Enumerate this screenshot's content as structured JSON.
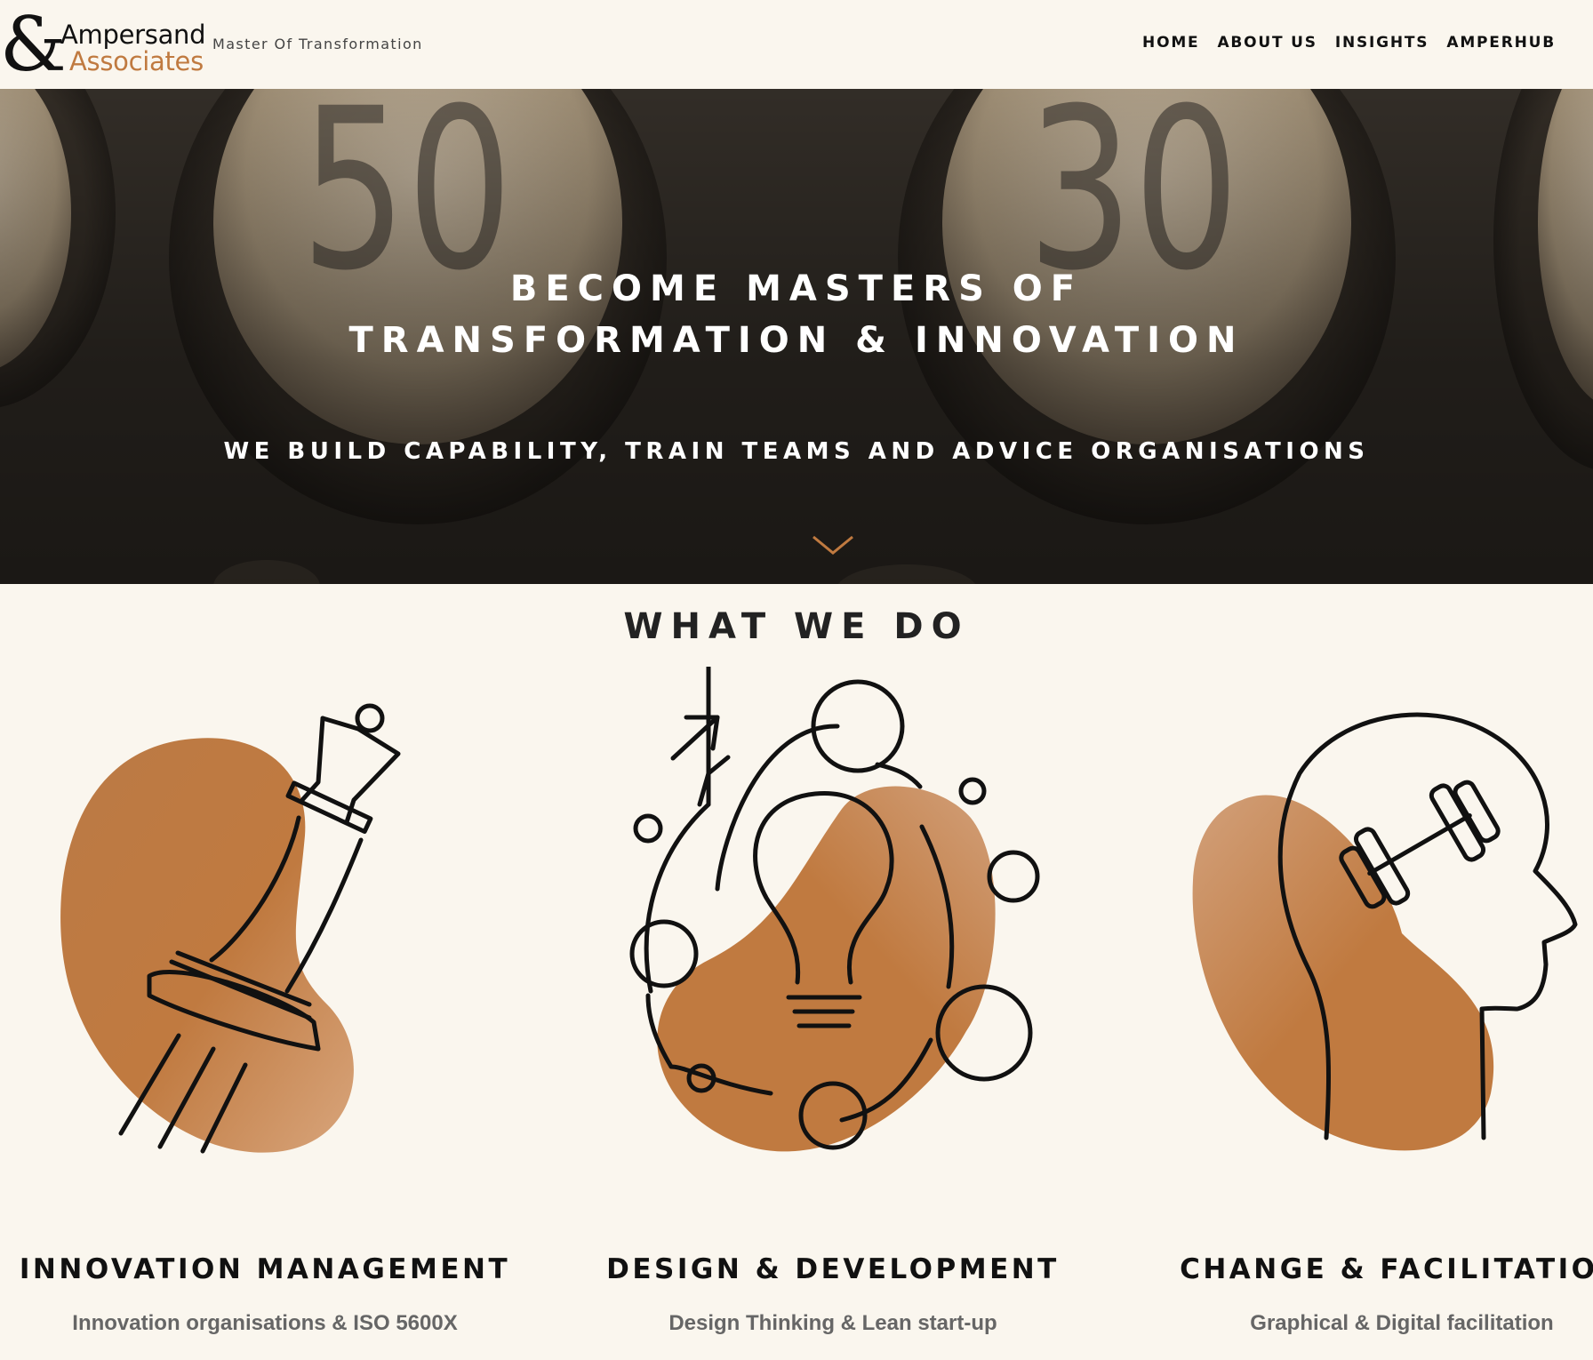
{
  "header": {
    "logo_symbol": "&",
    "logo_line1": "Ampersand",
    "logo_line2": "Associates",
    "tagline": "Master Of Transformation",
    "nav": [
      {
        "label": "HOME"
      },
      {
        "label": "ABOUT US"
      },
      {
        "label": "INSIGHTS"
      },
      {
        "label": "AMPERHUB"
      }
    ]
  },
  "hero": {
    "title_line1": "BECOME MASTERS OF",
    "title_line2": "TRANSFORMATION & INNOVATION",
    "subtitle": "WE BUILD CAPABILITY, TRAIN TEAMS AND ADVICE ORGANISATIONS",
    "background_numbers": [
      "50",
      "30"
    ],
    "scroll_icon": "chevron-down-icon"
  },
  "services": {
    "title": "WHAT WE DO",
    "items": [
      {
        "title": "INNOVATION MANAGEMENT",
        "subtitle": "Innovation organisations & ISO 5600X",
        "icon": "chess-queen-icon"
      },
      {
        "title": "DESIGN & DEVELOPMENT",
        "subtitle": "Design Thinking & Lean start-up",
        "icon": "lightbulb-icon"
      },
      {
        "title": "CHANGE & FACILITATION",
        "subtitle": "Graphical & Digital facilitation",
        "icon": "head-dumbbell-icon"
      }
    ]
  },
  "colors": {
    "background": "#faf6ee",
    "accent": "#c07a40",
    "text": "#111111"
  }
}
